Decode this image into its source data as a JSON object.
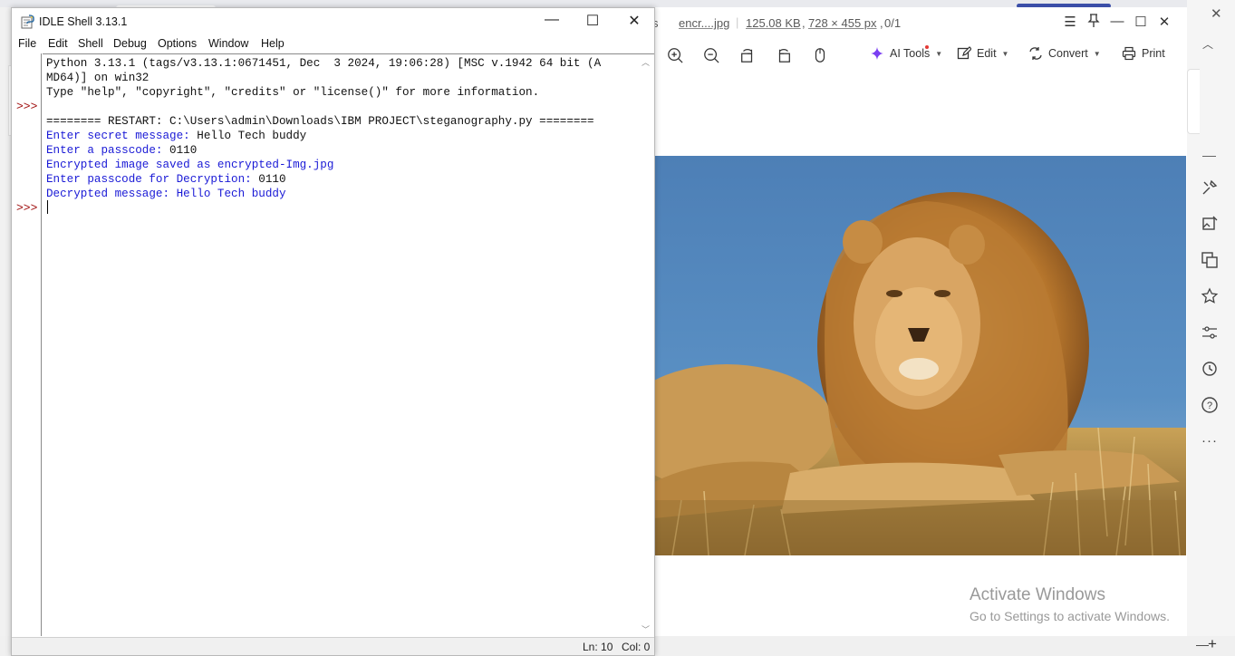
{
  "idle": {
    "title": "IDLE Shell 3.13.1",
    "menu": [
      "File",
      "Edit",
      "Shell",
      "Debug",
      "Options",
      "Window",
      "Help"
    ],
    "prompts": [
      ">>>",
      ">>>"
    ],
    "lines": [
      {
        "text": "Python 3.13.1 (tags/v3.13.1:0671451, Dec  3 2024, 19:06:28) [MSC v.1942 64 bit (A",
        "color": "black"
      },
      {
        "text": "MD64)] on win32",
        "color": "black"
      },
      {
        "text": "Type \"help\", \"copyright\", \"credits\" or \"license()\" for more information.",
        "color": "black"
      },
      {
        "text": "======== RESTART: C:\\Users\\admin\\Downloads\\IBM PROJECT\\steganography.py ========",
        "color": "black"
      }
    ],
    "io": [
      {
        "prompt": "Enter secret message: ",
        "input": "Hello Tech buddy"
      },
      {
        "prompt": "Enter a passcode: ",
        "input": "0110"
      },
      {
        "prompt": "Encrypted image saved as encrypted-Img.jpg",
        "input": ""
      },
      {
        "prompt": "Enter passcode for Decryption: ",
        "input": "0110"
      },
      {
        "prompt": "Decrypted message: Hello Tech buddy",
        "input": ""
      }
    ],
    "status": {
      "ln": "Ln: 10",
      "col": "Col: 0"
    }
  },
  "viewer": {
    "tab_fragment": "s",
    "filename": "encr....jpg",
    "filesize": "125.08 KB",
    "dimensions": "728 × 455 px",
    "page": "0/1",
    "toolbar": {
      "ai_tools": "AI Tools",
      "edit": "Edit",
      "convert": "Convert",
      "print": "Print"
    },
    "watermark": {
      "title": "Activate Windows",
      "subtitle": "Go to Settings to activate Windows."
    }
  },
  "colors": {
    "prompt": "#a01010",
    "stdout": "#1a1ad6",
    "ai_accent": "#7b3ff2"
  }
}
